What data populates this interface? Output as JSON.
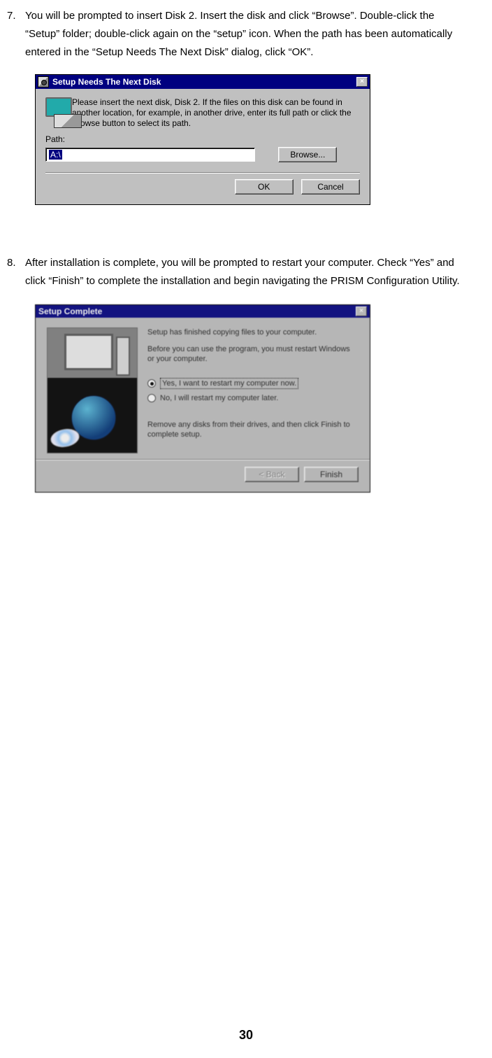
{
  "step7": {
    "num": "7.",
    "text": "You will be prompted to insert Disk 2. Insert the disk and click “Browse”. Double-click the “Setup” folder; double-click again on the “setup” icon. When the path has been automatically entered in the “Setup Needs The Next Disk” dialog, click “OK”."
  },
  "dialog1": {
    "title": "Setup Needs The Next Disk",
    "close": "×",
    "message": "Please insert the next disk, Disk 2. If the files on this disk can be found in another location, for example, in another drive, enter its full path or click the Browse button to select its path.",
    "path_label": "Path:",
    "path_value": "A:\\",
    "browse": "Browse...",
    "ok": "OK",
    "cancel": "Cancel"
  },
  "step8": {
    "num": "8.",
    "text": "After installation is complete, you will be prompted to restart your computer. Check “Yes” and click “Finish” to complete the installation and begin navigating the PRISM Configuration Utility."
  },
  "dialog2": {
    "title": "Setup Complete",
    "line1": "Setup has finished copying files to your computer.",
    "line2": "Before you can use the program, you must restart Windows or your computer.",
    "opt_yes": "Yes, I want to restart my computer now.",
    "opt_no": "No, I will restart my computer later.",
    "line3": "Remove any disks from their drives, and then click Finish to complete setup.",
    "back": "< Back",
    "finish": "Finish"
  },
  "page_number": "30"
}
